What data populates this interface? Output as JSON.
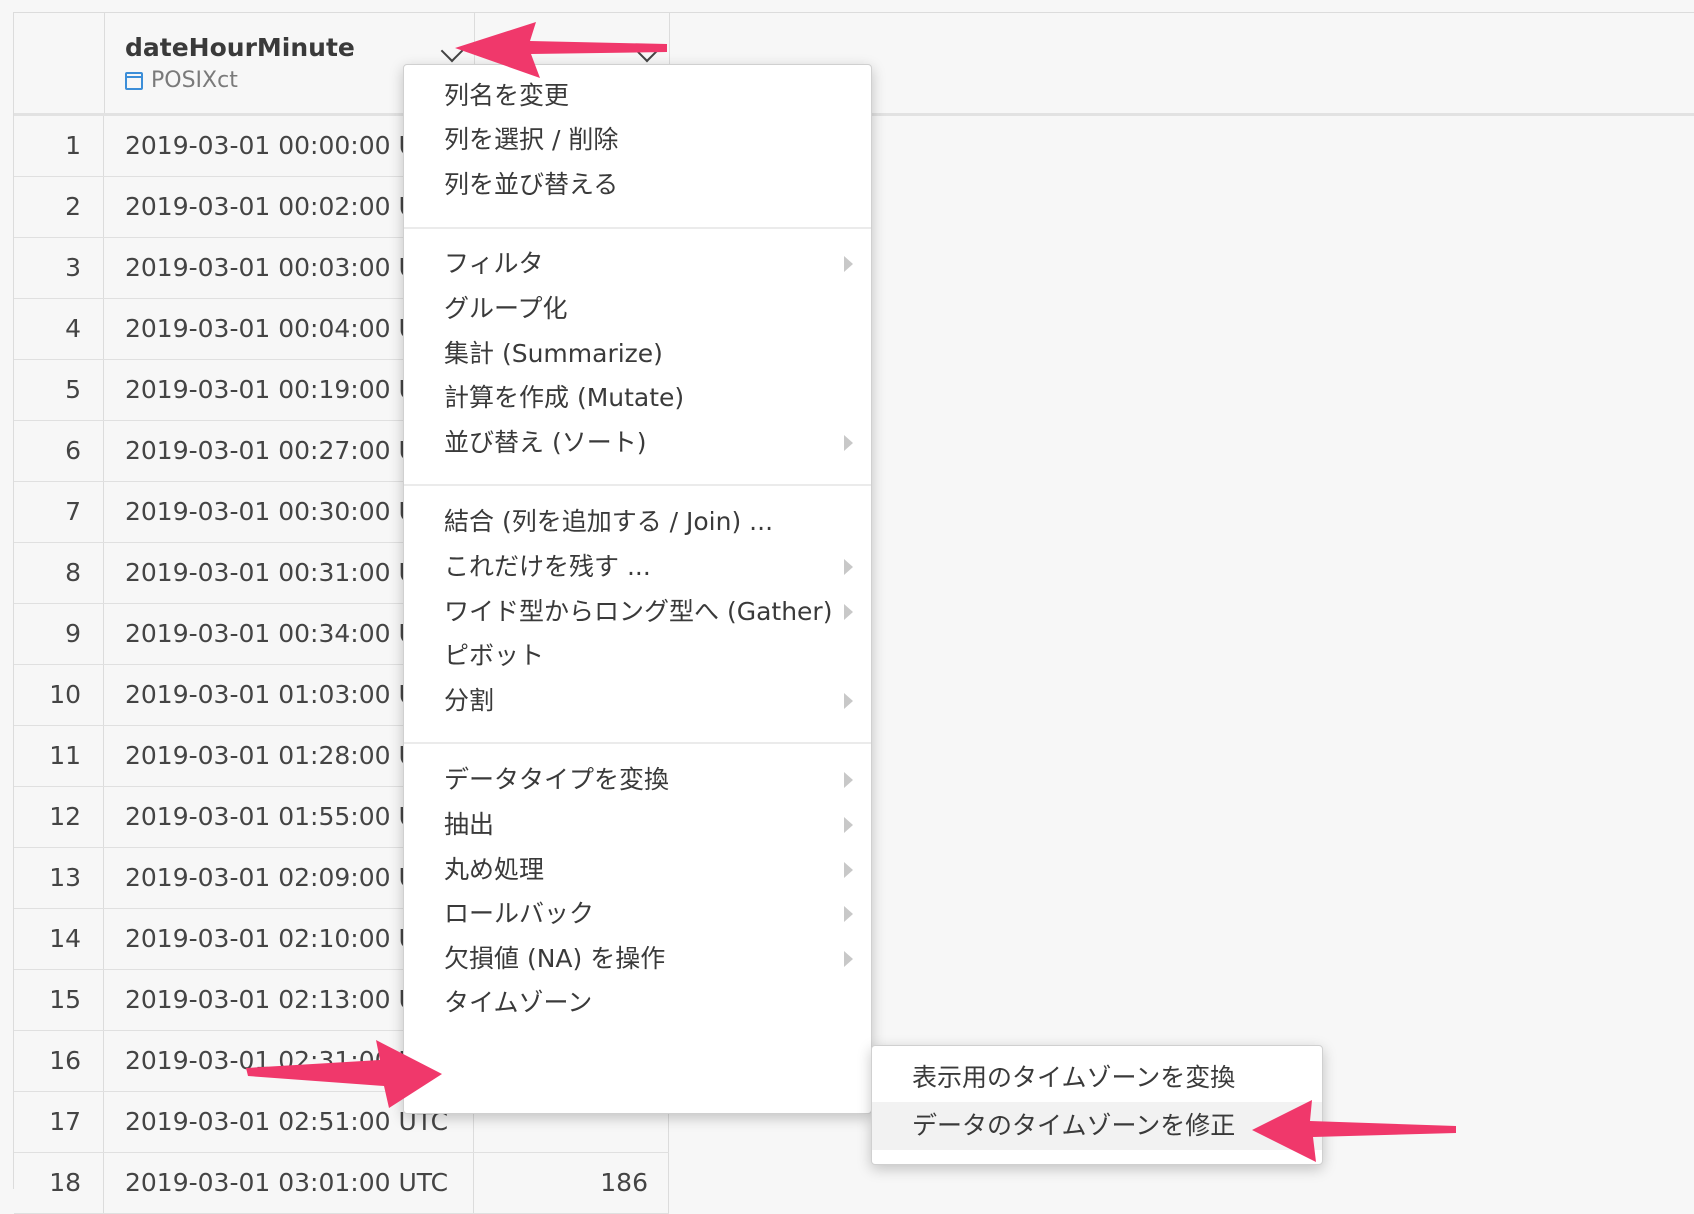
{
  "columns": {
    "date": {
      "name": "dateHourMinute",
      "type": "POSIXct",
      "type_icon": "calendar-icon",
      "dropdown_icon": "chevron-down-icon"
    },
    "value": {
      "dropdown_icon": "chevron-down-icon"
    }
  },
  "rows": [
    {
      "num": "1",
      "date": "2019-03-01 00:00:00 UTC"
    },
    {
      "num": "2",
      "date": "2019-03-01 00:02:00 UTC"
    },
    {
      "num": "3",
      "date": "2019-03-01 00:03:00 UTC"
    },
    {
      "num": "4",
      "date": "2019-03-01 00:04:00 UTC"
    },
    {
      "num": "5",
      "date": "2019-03-01 00:19:00 UTC"
    },
    {
      "num": "6",
      "date": "2019-03-01 00:27:00 UTC"
    },
    {
      "num": "7",
      "date": "2019-03-01 00:30:00 UTC"
    },
    {
      "num": "8",
      "date": "2019-03-01 00:31:00 UTC"
    },
    {
      "num": "9",
      "date": "2019-03-01 00:34:00 UTC"
    },
    {
      "num": "10",
      "date": "2019-03-01 01:03:00 UTC"
    },
    {
      "num": "11",
      "date": "2019-03-01 01:28:00 UTC"
    },
    {
      "num": "12",
      "date": "2019-03-01 01:55:00 UTC"
    },
    {
      "num": "13",
      "date": "2019-03-01 02:09:00 UTC"
    },
    {
      "num": "14",
      "date": "2019-03-01 02:10:00 UTC"
    },
    {
      "num": "15",
      "date": "2019-03-01 02:13:00 UTC"
    },
    {
      "num": "16",
      "date": "2019-03-01 02:31:00 UTC"
    },
    {
      "num": "17",
      "date": "2019-03-01 02:51:00 UTC"
    },
    {
      "num": "18",
      "date": "2019-03-01 03:01:00 UTC",
      "value": "186"
    }
  ],
  "menu": {
    "rename": "列名を変更",
    "select_delete": "列を選択 / 削除",
    "reorder": "列を並び替える",
    "filter": "フィルタ",
    "group": "グループ化",
    "summarize": "集計 (Summarize)",
    "mutate": "計算を作成 (Mutate)",
    "sort": "並び替え (ソート)",
    "join": "結合 (列を追加する / Join) ...",
    "keep_only": "これだけを残す ...",
    "gather": "ワイド型からロング型へ (Gather)",
    "pivot": "ピボット",
    "split": "分割",
    "convert_type": "データタイプを変換",
    "extract": "抽出",
    "round": "丸め処理",
    "rollback": "ロールバック",
    "na": "欠損値 (NA) を操作",
    "timezone": "タイムゾーン"
  },
  "submenu": {
    "convert_display_tz": "表示用のタイムゾーンを変換",
    "fix_data_tz": "データのタイムゾーンを修正"
  },
  "colors": {
    "annotation_arrow": "#f0386b",
    "calendar_icon": "#3c8ed8"
  }
}
